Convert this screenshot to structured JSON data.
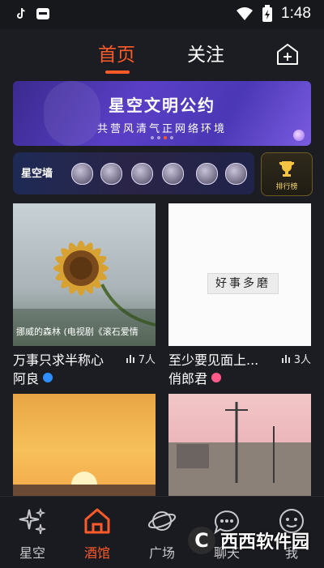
{
  "status": {
    "time": "1:48"
  },
  "topnav": {
    "tabs": [
      {
        "label": "首页",
        "active": true
      },
      {
        "label": "关注",
        "active": false
      }
    ],
    "accent": "#ff5a2a"
  },
  "banner": {
    "title": "星空文明公约",
    "subtitle": "共营风清气正网络环境",
    "slide_count": 4,
    "active_slide": 2
  },
  "star_wall": {
    "label": "星空墙",
    "avatar_count": 7
  },
  "ranking": {
    "label": "排行榜",
    "icon": "trophy-icon"
  },
  "feed": [
    {
      "image": "sunflower",
      "caption": "挪威的森林 (电视剧《滚石爱情",
      "title": "万事只求半称心",
      "count": "7人",
      "author": "阿良",
      "badge_color": "#2f8fff"
    },
    {
      "image": "white",
      "tag": "好事多磨",
      "title": "至少要见面上...",
      "count": "3人",
      "author": "俏郎君",
      "badge_color": "#ff5a8a"
    },
    {
      "image": "sunset"
    },
    {
      "image": "street"
    }
  ],
  "bottomnav": {
    "items": [
      {
        "label": "星空",
        "icon": "sparkle-icon",
        "active": false
      },
      {
        "label": "酒馆",
        "icon": "home-icon",
        "active": true
      },
      {
        "label": "广场",
        "icon": "planet-icon",
        "active": false
      },
      {
        "label": "聊天",
        "icon": "chat-bubble-icon",
        "active": false
      },
      {
        "label": "我",
        "icon": "profile-icon",
        "active": false
      }
    ]
  },
  "watermark": {
    "text": "西西软件园",
    "logo": "C"
  }
}
